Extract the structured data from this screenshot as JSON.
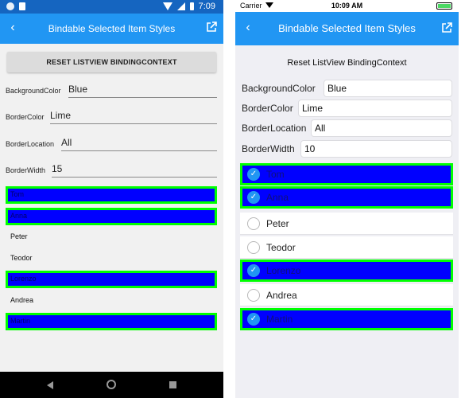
{
  "android": {
    "status_time": "7:09",
    "title": "Bindable Selected Item Styles",
    "back_glyph": "‹",
    "reset_label": "RESET LISTVIEW BINDINGCONTEXT",
    "fields": [
      {
        "label": "BackgroundColor",
        "value": "Blue"
      },
      {
        "label": "BorderColor",
        "value": "Lime"
      },
      {
        "label": "BorderLocation",
        "value": "All"
      },
      {
        "label": "BorderWidth",
        "value": "15"
      }
    ],
    "items": [
      {
        "text": "Tom",
        "selected": true
      },
      {
        "text": "Anna",
        "selected": true
      },
      {
        "text": "Peter",
        "selected": false
      },
      {
        "text": "Teodor",
        "selected": false
      },
      {
        "text": "Lorenzo",
        "selected": true
      },
      {
        "text": "Andrea",
        "selected": false
      },
      {
        "text": "Martin",
        "selected": true
      }
    ]
  },
  "ios": {
    "carrier": "Carrier",
    "status_time": "10:09 AM",
    "title": "Bindable Selected Item Styles",
    "back_glyph": "‹",
    "reset_label": "Reset ListView BindingContext",
    "check_glyph": "✓",
    "fields": [
      {
        "label": "BackgroundColor",
        "value": "Blue"
      },
      {
        "label": "BorderColor",
        "value": "Lime"
      },
      {
        "label": "BorderLocation",
        "value": "All"
      },
      {
        "label": "BorderWidth",
        "value": "10"
      }
    ],
    "items": [
      {
        "text": "Tom",
        "selected": true
      },
      {
        "text": "Anna",
        "selected": true
      },
      {
        "text": "Peter",
        "selected": false
      },
      {
        "text": "Teodor",
        "selected": false
      },
      {
        "text": "Lorenzo",
        "selected": true
      },
      {
        "text": "Andrea",
        "selected": false
      },
      {
        "text": "Martin",
        "selected": true
      }
    ]
  },
  "colors": {
    "header": "#2196f3",
    "selected_background": "#0000ff",
    "selected_border": "#00ff00"
  },
  "icons": [
    "back-arrow-icon",
    "external-link-icon",
    "wifi-icon",
    "battery-icon",
    "checkmark-icon"
  ]
}
